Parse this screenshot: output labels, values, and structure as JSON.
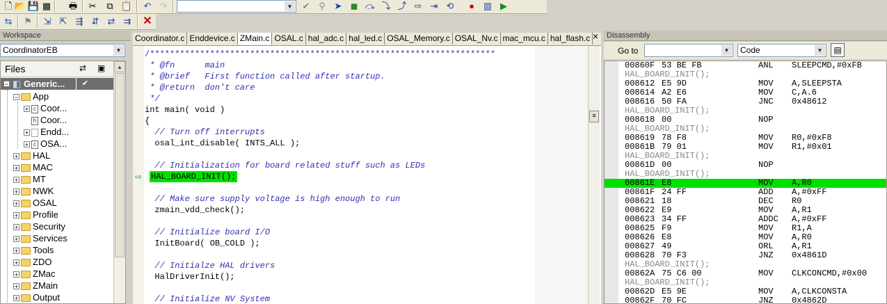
{
  "toolbar1": {
    "icons": [
      "new-file-icon",
      "open-icon",
      "save-icon",
      "save-all-icon",
      "print-icon",
      "cut-icon",
      "copy-icon",
      "paste-icon",
      "undo-icon",
      "redo-icon"
    ],
    "combo_value": "",
    "debug_icons": [
      "toggle-breakpoint-icon",
      "find-icon",
      "go-icon",
      "stop-icon",
      "step-over-icon",
      "step-into-icon",
      "step-out-icon",
      "next-statement-icon",
      "run-to-cursor-icon",
      "reset-icon",
      "break-icon",
      "make-icon",
      "download-debug-icon"
    ]
  },
  "toolbar2": {
    "close_glyph": "✕"
  },
  "workspace": {
    "title": "Workspace",
    "config": "CoordinatorEB",
    "files_header": "Files",
    "root": "Generic...",
    "root_check": "✔",
    "items": [
      {
        "label": "App",
        "type": "folder",
        "level": 1,
        "expander": "−"
      },
      {
        "label": "Coor...",
        "type": "c",
        "level": 2,
        "expander": "+"
      },
      {
        "label": "Coor...",
        "type": "h",
        "level": 2,
        "expander": ""
      },
      {
        "label": "Endd...",
        "type": "x",
        "level": 2,
        "expander": "+"
      },
      {
        "label": "OSA...",
        "type": "c",
        "level": 2,
        "expander": "+"
      },
      {
        "label": "HAL",
        "type": "folder",
        "level": 1,
        "expander": "+"
      },
      {
        "label": "MAC",
        "type": "folder",
        "level": 1,
        "expander": "+"
      },
      {
        "label": "MT",
        "type": "folder",
        "level": 1,
        "expander": "+"
      },
      {
        "label": "NWK",
        "type": "folder",
        "level": 1,
        "expander": "+"
      },
      {
        "label": "OSAL",
        "type": "folder",
        "level": 1,
        "expander": "+"
      },
      {
        "label": "Profile",
        "type": "folder",
        "level": 1,
        "expander": "+"
      },
      {
        "label": "Security",
        "type": "folder",
        "level": 1,
        "expander": "+"
      },
      {
        "label": "Services",
        "type": "folder",
        "level": 1,
        "expander": "+"
      },
      {
        "label": "Tools",
        "type": "folder",
        "level": 1,
        "expander": "+"
      },
      {
        "label": "ZDO",
        "type": "folder",
        "level": 1,
        "expander": "+"
      },
      {
        "label": "ZMac",
        "type": "folder",
        "level": 1,
        "expander": "+"
      },
      {
        "label": "ZMain",
        "type": "folder",
        "level": 1,
        "expander": "+"
      },
      {
        "label": "Output",
        "type": "folder",
        "level": 1,
        "expander": "+"
      }
    ]
  },
  "editor": {
    "tabs": [
      "Coordinator.c",
      "Enddevice.c",
      "ZMain.c",
      "OSAL.c",
      "hal_adc.c",
      "hal_led.c",
      "OSAL_Memory.c",
      "OSAL_Nv.c",
      "mac_mcu.c",
      "hal_flash.c"
    ],
    "active_tab": "ZMain.c",
    "close_glyph": "×",
    "lines": [
      {
        "t": "/*********************************************************************",
        "k": "star"
      },
      {
        "t": " * @fn      main",
        "k": "cm"
      },
      {
        "t": " * @brief   First function called after startup.",
        "k": "cm"
      },
      {
        "t": " * @return  don't care",
        "k": "cm"
      },
      {
        "t": " */",
        "k": "cm"
      },
      {
        "t": "int main( void )",
        "k": "code"
      },
      {
        "t": "{",
        "k": "code"
      },
      {
        "t": "  // Turn off interrupts",
        "k": "cm"
      },
      {
        "t": "  osal_int_disable( INTS_ALL );",
        "k": "code"
      },
      {
        "t": "",
        "k": "code"
      },
      {
        "t": "  // Initialization for board related stuff such as LEDs",
        "k": "cm"
      },
      {
        "t": "HAL_BOARD_INIT();",
        "k": "current"
      },
      {
        "t": "",
        "k": "code"
      },
      {
        "t": "  // Make sure supply voltage is high enough to run",
        "k": "cm"
      },
      {
        "t": "  zmain_vdd_check();",
        "k": "code"
      },
      {
        "t": "",
        "k": "code"
      },
      {
        "t": "  // Initialize board I/O",
        "k": "cm"
      },
      {
        "t": "  InitBoard( OB_COLD );",
        "k": "code"
      },
      {
        "t": "",
        "k": "code"
      },
      {
        "t": "  // Initialze HAL drivers",
        "k": "cm"
      },
      {
        "t": "  HalDriverInit();",
        "k": "code"
      },
      {
        "t": "",
        "k": "code"
      },
      {
        "t": "  // Initialize NV System",
        "k": "cm"
      }
    ]
  },
  "disassembly": {
    "title": "Disassembly",
    "goto_label": "Go to",
    "goto_value": "",
    "mode_value": "Code",
    "rows": [
      {
        "addr": "00860F",
        "bytes": "53 BE FB",
        "op": "ANL",
        "args": "SLEEPCMD,#0xFB"
      },
      {
        "src": "HAL_BOARD_INIT();"
      },
      {
        "addr": "008612",
        "bytes": "E5 9D",
        "op": "MOV",
        "args": "A,SLEEPSTA"
      },
      {
        "addr": "008614",
        "bytes": "A2 E6",
        "op": "MOV",
        "args": "C,A.6"
      },
      {
        "addr": "008616",
        "bytes": "50 FA",
        "op": "JNC",
        "args": "0x48612"
      },
      {
        "src": "HAL_BOARD_INIT();"
      },
      {
        "addr": "008618",
        "bytes": "00",
        "op": "NOP",
        "args": ""
      },
      {
        "src": "HAL_BOARD_INIT();"
      },
      {
        "addr": "008619",
        "bytes": "78 F8",
        "op": "MOV",
        "args": "R0,#0xF8"
      },
      {
        "addr": "00861B",
        "bytes": "79 01",
        "op": "MOV",
        "args": "R1,#0x01"
      },
      {
        "src": "HAL_BOARD_INIT();"
      },
      {
        "addr": "00861D",
        "bytes": "00",
        "op": "NOP",
        "args": ""
      },
      {
        "src": "HAL_BOARD_INIT();"
      },
      {
        "addr": "00861E",
        "bytes": "E8",
        "op": "MOV",
        "args": "A,R0",
        "current": true
      },
      {
        "addr": "00861F",
        "bytes": "24 FF",
        "op": "ADD",
        "args": "A,#0xFF"
      },
      {
        "addr": "008621",
        "bytes": "18",
        "op": "DEC",
        "args": "R0"
      },
      {
        "addr": "008622",
        "bytes": "E9",
        "op": "MOV",
        "args": "A,R1"
      },
      {
        "addr": "008623",
        "bytes": "34 FF",
        "op": "ADDC",
        "args": "A,#0xFF"
      },
      {
        "addr": "008625",
        "bytes": "F9",
        "op": "MOV",
        "args": "R1,A"
      },
      {
        "addr": "008626",
        "bytes": "E8",
        "op": "MOV",
        "args": "A,R0"
      },
      {
        "addr": "008627",
        "bytes": "49",
        "op": "ORL",
        "args": "A,R1"
      },
      {
        "addr": "008628",
        "bytes": "70 F3",
        "op": "JNZ",
        "args": "0x4861D"
      },
      {
        "src": "HAL_BOARD_INIT();"
      },
      {
        "addr": "00862A",
        "bytes": "75 C6 00",
        "op": "MOV",
        "args": "CLKCONCMD,#0x00"
      },
      {
        "src": "HAL_BOARD_INIT();"
      },
      {
        "addr": "00862D",
        "bytes": "E5 9E",
        "op": "MOV",
        "args": "A,CLKCONSTA"
      },
      {
        "addr": "00862F",
        "bytes": "70 FC",
        "op": "JNZ",
        "args": "0x4862D"
      }
    ]
  }
}
